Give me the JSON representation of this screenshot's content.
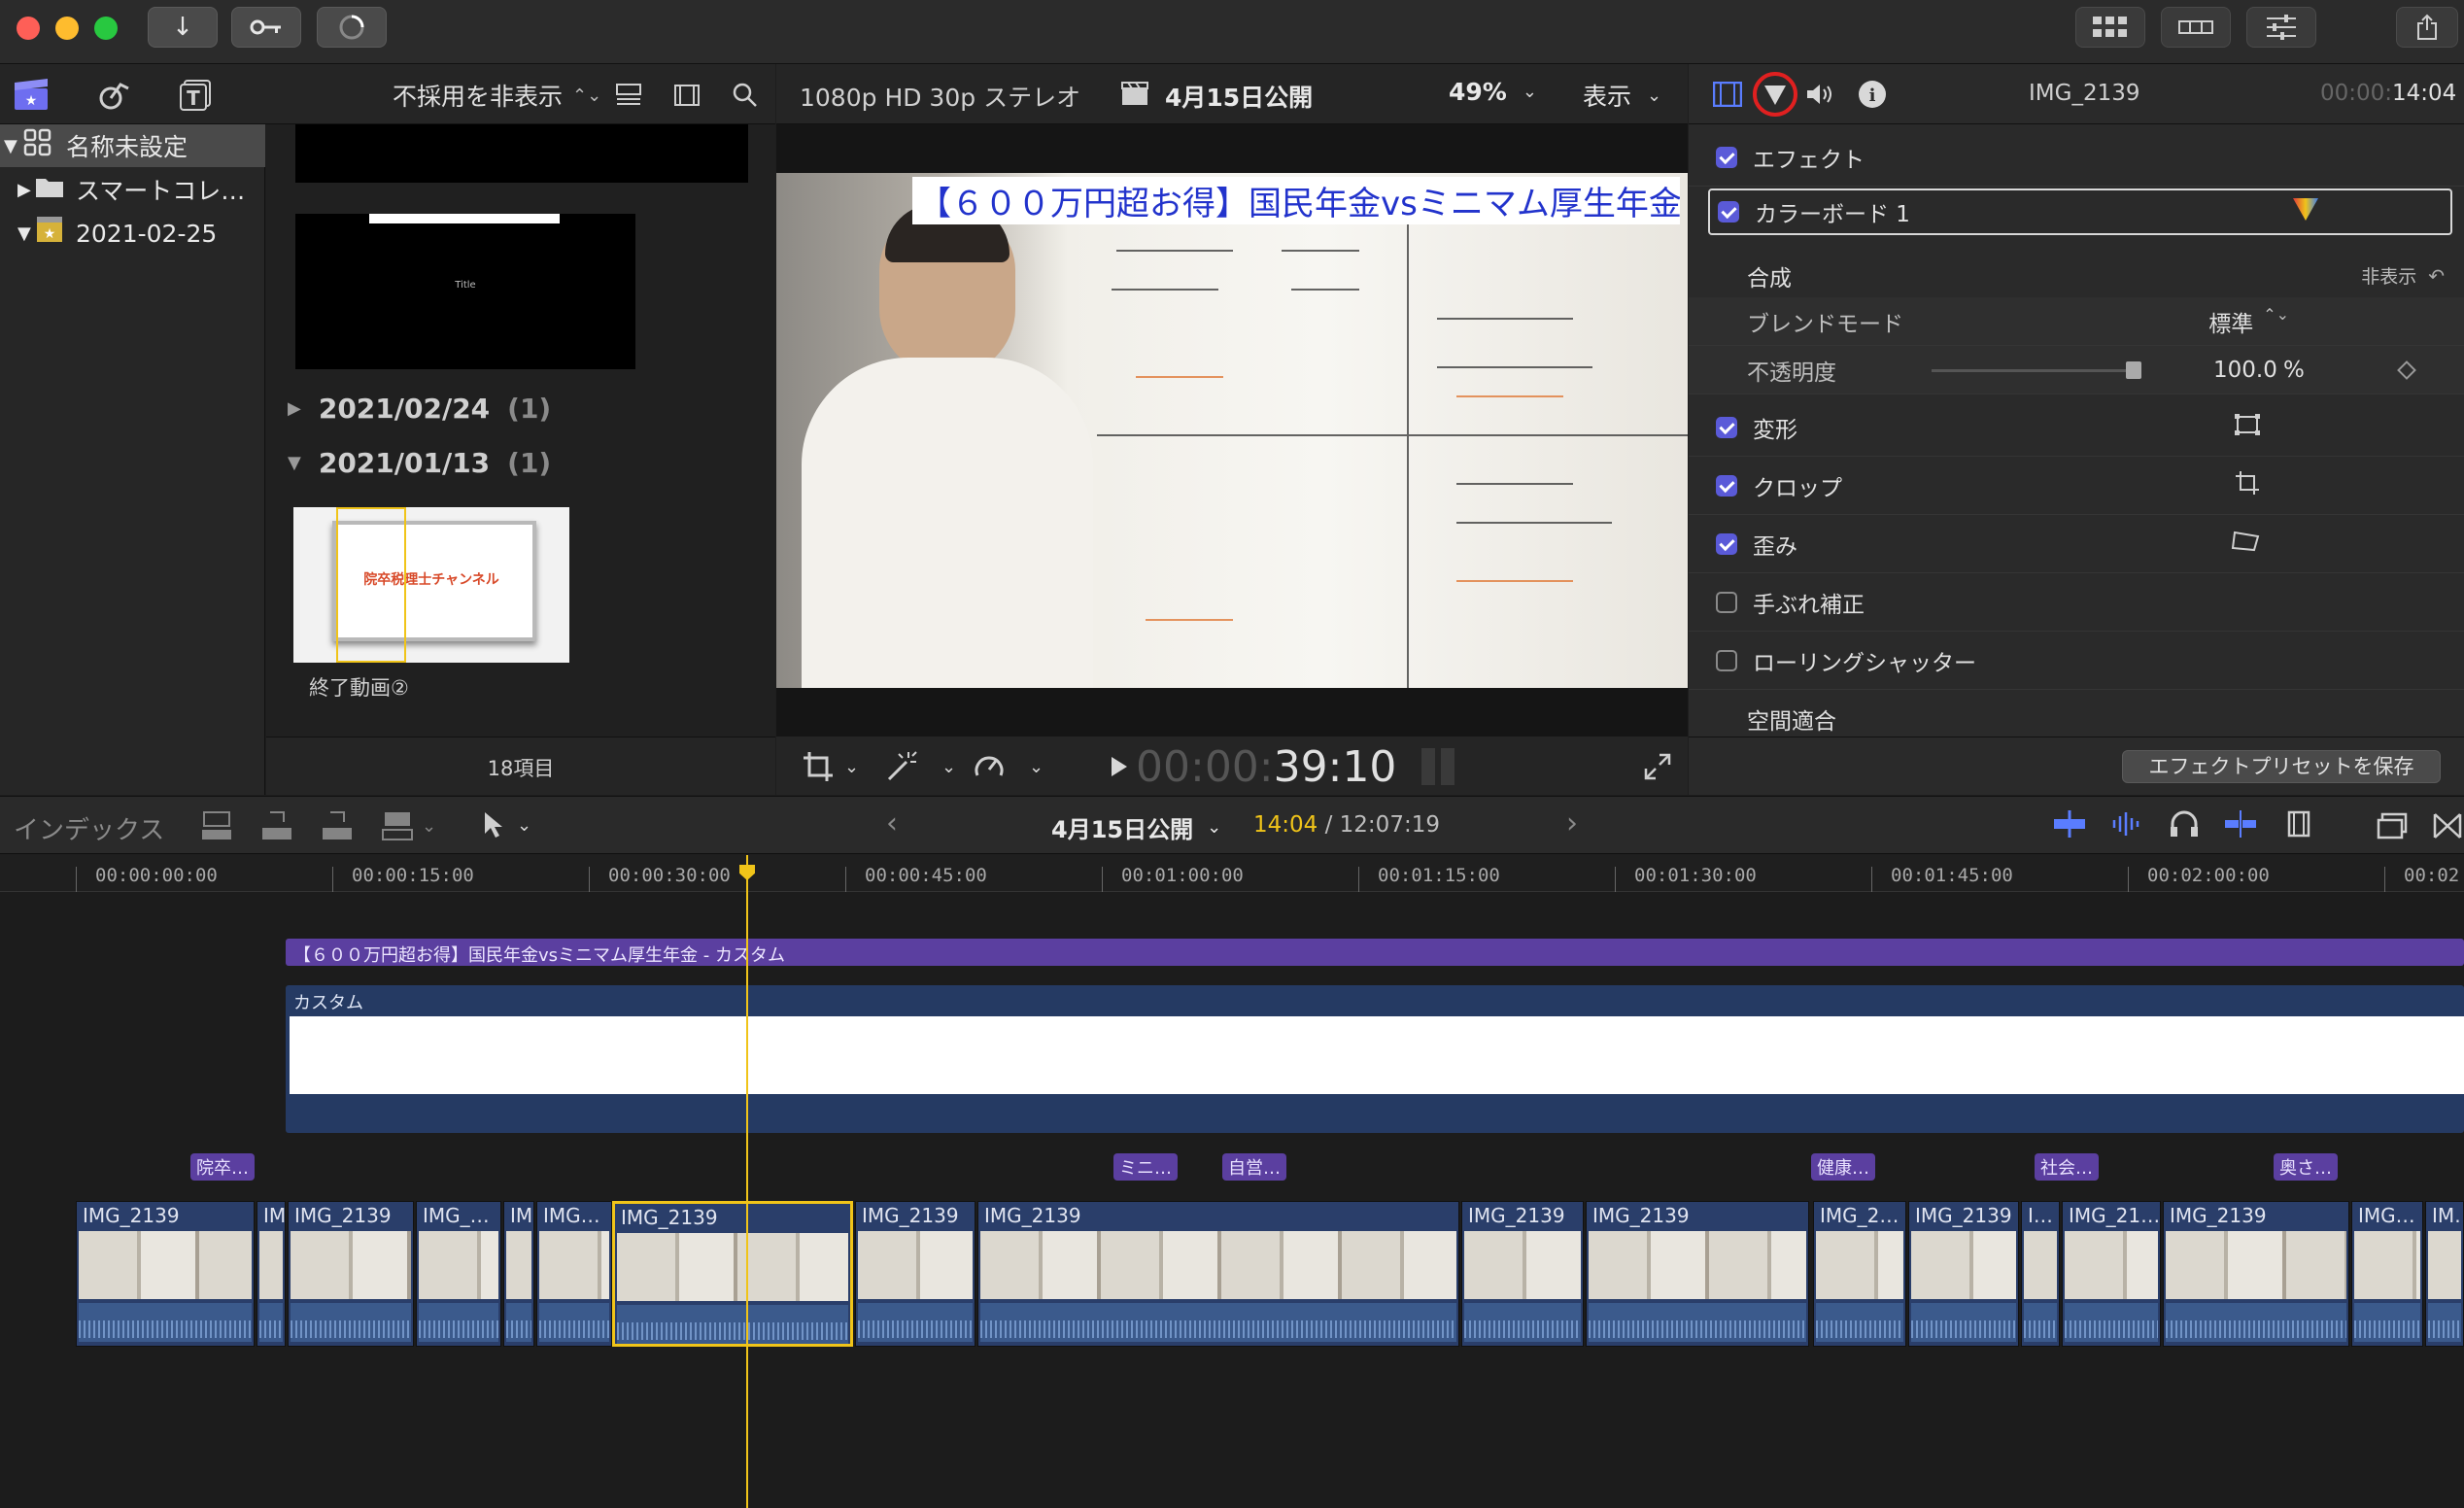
{
  "titlebar": {
    "download_icon": "↓",
    "key_icon": "key-icon",
    "progress_icon": "progress-icon"
  },
  "browser": {
    "filter_label": "不採用を非表示",
    "libraries": [
      {
        "label": "名称未設定"
      },
      {
        "label": "スマートコレ…"
      },
      {
        "label": "2021-02-25"
      }
    ],
    "dates": [
      {
        "label": "2021/02/24",
        "count": "(1)"
      },
      {
        "label": "2021/01/13",
        "count": "(1)"
      }
    ],
    "thumb_title": "Title",
    "clip_thumb_text": "院卒税理士チャンネル",
    "clip_caption": "終了動画②",
    "footer_count": "18項目"
  },
  "viewer": {
    "format": "1080p HD 30p ステレオ",
    "project": "4月15日公開",
    "zoom": "49%",
    "view_menu": "表示",
    "video_title": "【６００万円超お得】国民年金vsミニマム厚生年金",
    "timecode_dim": "00:00:",
    "timecode": "39:10"
  },
  "inspector": {
    "clip_name": "IMG_2139",
    "duration_dim": "00:00:",
    "duration": "14:04",
    "rows": {
      "effects": "エフェクト",
      "colorboard": "カラーボード 1",
      "composite": "合成",
      "hide": "非表示",
      "blend_mode": "ブレンドモード",
      "blend_value": "標準",
      "opacity": "不透明度",
      "opacity_value": "100.0",
      "opacity_unit": "%",
      "transform": "変形",
      "crop": "クロップ",
      "distort": "歪み",
      "stabilization": "手ぶれ補正",
      "rolling_shutter": "ローリングシャッター",
      "spatial_conform": "空間適合"
    },
    "save_preset": "エフェクトプリセットを保存"
  },
  "timeline": {
    "index_label": "インデックス",
    "project": "4月15日公開",
    "position": "14:04",
    "total": " / 12:07:19",
    "ruler": [
      "00:00:00:00",
      "00:00:15:00",
      "00:00:30:00",
      "00:00:45:00",
      "00:01:00:00",
      "00:01:15:00",
      "00:01:30:00",
      "00:01:45:00",
      "00:02:00:00",
      "00:02"
    ],
    "title_clip": "【６００万円超お得】国民年金vsミニマム厚生年金 - カスタム",
    "custom_clip": "カスタム",
    "markers": [
      "院卒…",
      "ミニ…",
      "自営…",
      "健康…",
      "社会…",
      "奥さ…"
    ],
    "clips": [
      "IMG_2139",
      "IM",
      "IMG_2139",
      "IMG_…",
      "IM",
      "IMG…",
      "IMG_2139",
      "IMG_2139",
      "IMG_2139",
      "IMG_2139",
      "IMG_2139",
      "IMG_2…",
      "IMG_2139",
      "I…",
      "IMG_21…",
      "IMG_2139",
      "IMG…",
      "IM…"
    ]
  },
  "colors": {
    "accent": "#5a5ad8",
    "playhead": "#f0c419",
    "title_clip": "#5b3fa0",
    "clip_blue": "#2a3e6a",
    "highlight_ring": "#e02020"
  }
}
